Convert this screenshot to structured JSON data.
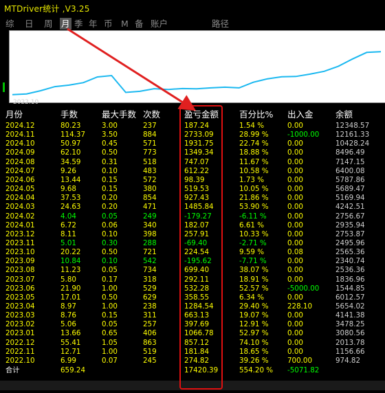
{
  "window": {
    "title": "MTDriver统计 ,V3.25"
  },
  "tabs": [
    {
      "label": "综",
      "active": false
    },
    {
      "label": "日",
      "active": false
    },
    {
      "label": "周",
      "active": false
    },
    {
      "label": "月",
      "active": true
    },
    {
      "label": "季",
      "active": false
    },
    {
      "label": "年",
      "active": false
    },
    {
      "label": "币",
      "active": false
    },
    {
      "label": "M",
      "active": false
    },
    {
      "label": "备",
      "active": false
    },
    {
      "label": "账户",
      "active": false
    },
    {
      "label": "路径",
      "active": false
    }
  ],
  "equity_chart": {
    "x_label": "2022.10",
    "line_color": "#1ab8f0",
    "arrow_color": "#e02020",
    "note_monthly_pnl_source": "balance curve"
  },
  "table": {
    "headers": [
      "月份",
      "手数",
      "最大手数",
      "次数",
      "盈亏金额",
      "百分比%",
      "出入金",
      "余额"
    ],
    "rows": [
      [
        "2024.12",
        "80.23",
        "3.00",
        "237",
        "187.24",
        "1.54 %",
        "0.00",
        "12348.57"
      ],
      [
        "2024.11",
        "114.37",
        "3.50",
        "884",
        "2733.09",
        "28.99 %",
        "-1000.00",
        "12161.33"
      ],
      [
        "2024.10",
        "50.97",
        "0.45",
        "571",
        "1931.75",
        "22.74 %",
        "0.00",
        "10428.24"
      ],
      [
        "2024.09",
        "62.10",
        "0.50",
        "773",
        "1349.34",
        "18.88 %",
        "0.00",
        "8496.49"
      ],
      [
        "2024.08",
        "34.59",
        "0.31",
        "518",
        "747.07",
        "11.67 %",
        "0.00",
        "7147.15"
      ],
      [
        "2024.07",
        "9.26",
        "0.10",
        "483",
        "612.22",
        "10.58 %",
        "0.00",
        "6400.08"
      ],
      [
        "2024.06",
        "13.44",
        "0.15",
        "572",
        "98.39",
        "1.73 %",
        "0.00",
        "5787.86"
      ],
      [
        "2024.05",
        "9.68",
        "0.15",
        "380",
        "519.53",
        "10.05 %",
        "0.00",
        "5689.47"
      ],
      [
        "2024.04",
        "37.53",
        "0.20",
        "854",
        "927.43",
        "21.86 %",
        "0.00",
        "5169.94"
      ],
      [
        "2024.03",
        "24.63",
        "0.20",
        "471",
        "1485.84",
        "53.90 %",
        "0.00",
        "4242.51"
      ],
      [
        "2024.02",
        "4.04",
        "0.05",
        "249",
        "-179.27",
        "-6.11 %",
        "0.00",
        "2756.67"
      ],
      [
        "2024.01",
        "6.72",
        "0.06",
        "340",
        "182.07",
        "6.61 %",
        "0.00",
        "2935.94"
      ],
      [
        "2023.12",
        "8.11",
        "0.10",
        "398",
        "257.91",
        "10.33 %",
        "0.00",
        "2753.87"
      ],
      [
        "2023.11",
        "5.01",
        "0.30",
        "288",
        "-69.40",
        "-2.71 %",
        "0.00",
        "2495.96"
      ],
      [
        "2023.10",
        "20.22",
        "0.50",
        "721",
        "224.54",
        "9.59 %",
        "0.08",
        "2565.36"
      ],
      [
        "2023.09",
        "10.84",
        "0.10",
        "542",
        "-195.62",
        "-7.71 %",
        "0.00",
        "2340.74"
      ],
      [
        "2023.08",
        "11.23",
        "0.05",
        "734",
        "699.40",
        "38.07 %",
        "0.00",
        "2536.36"
      ],
      [
        "2023.07",
        "5.80",
        "0.17",
        "318",
        "292.11",
        "18.91 %",
        "0.00",
        "1836.96"
      ],
      [
        "2023.06",
        "21.90",
        "1.00",
        "529",
        "532.28",
        "52.57 %",
        "-5000.00",
        "1544.85"
      ],
      [
        "2023.05",
        "17.01",
        "0.50",
        "629",
        "358.55",
        "6.34 %",
        "0.00",
        "6012.57"
      ],
      [
        "2023.04",
        "8.97",
        "1.00",
        "238",
        "1284.54",
        "29.40 %",
        "228.10",
        "5654.02"
      ],
      [
        "2023.03",
        "8.76",
        "0.15",
        "311",
        "663.13",
        "19.07 %",
        "0.00",
        "4141.38"
      ],
      [
        "2023.02",
        "5.06",
        "0.05",
        "257",
        "397.69",
        "12.91 %",
        "0.00",
        "3478.25"
      ],
      [
        "2023.01",
        "13.66",
        "0.65",
        "406",
        "1066.78",
        "52.97 %",
        "0.00",
        "3080.56"
      ],
      [
        "2022.12",
        "55.41",
        "1.05",
        "863",
        "857.12",
        "74.10 %",
        "0.00",
        "2013.78"
      ],
      [
        "2022.11",
        "12.71",
        "1.00",
        "519",
        "181.84",
        "18.65 %",
        "0.00",
        "1156.66"
      ],
      [
        "2022.10",
        "6.99",
        "0.07",
        "245",
        "274.82",
        "39.26 %",
        "700.00",
        "974.82"
      ]
    ],
    "totals": [
      "合计",
      "659.24",
      "",
      "",
      "17420.39",
      "554.20 %",
      "-5071.82",
      ""
    ]
  },
  "colors": {
    "positive": "#ffff00",
    "negative": "#00ff00",
    "balance": "#cfcfcf",
    "highlight_border": "#e01010"
  }
}
